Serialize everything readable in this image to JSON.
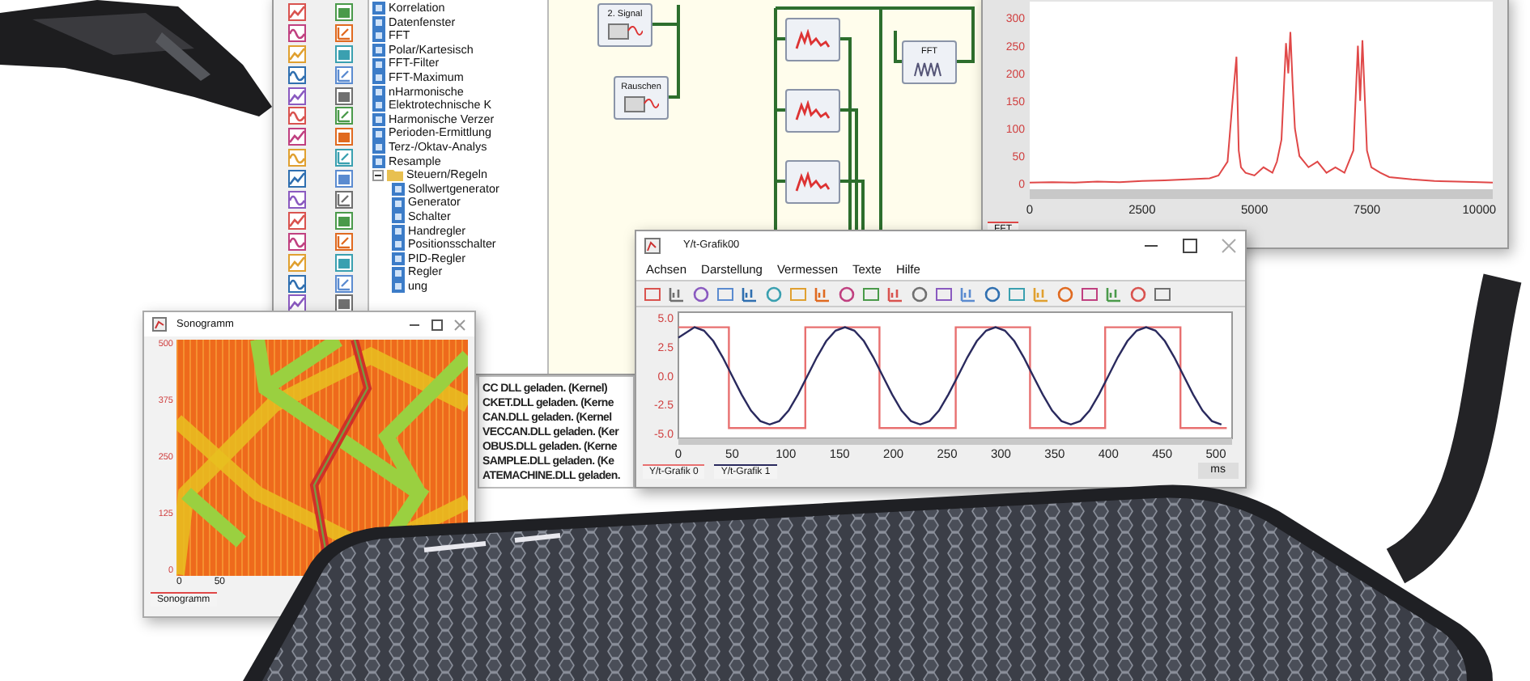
{
  "main_window": {
    "tree": {
      "items": [
        {
          "label": "Korrelation",
          "kind": "module"
        },
        {
          "label": "Datenfenster",
          "kind": "module"
        },
        {
          "label": "FFT",
          "kind": "module"
        },
        {
          "label": "Polar/Kartesisch",
          "kind": "module"
        },
        {
          "label": "FFT-Filter",
          "kind": "module"
        },
        {
          "label": "FFT-Maximum",
          "kind": "module"
        },
        {
          "label": "nHarmonische",
          "kind": "module"
        },
        {
          "label": "Elektrotechnische K",
          "kind": "module"
        },
        {
          "label": "Harmonische Verzer",
          "kind": "module"
        },
        {
          "label": "Perioden-Ermittlung",
          "kind": "module"
        },
        {
          "label": "Terz-/Oktav-Analys",
          "kind": "module"
        },
        {
          "label": "Resample",
          "kind": "module"
        },
        {
          "label": "Steuern/Regeln",
          "kind": "folder",
          "expanded": true,
          "children": [
            {
              "label": "Sollwertgenerator",
              "kind": "module"
            },
            {
              "label": "Generator",
              "kind": "module"
            },
            {
              "label": "Schalter",
              "kind": "module"
            },
            {
              "label": "Handregler",
              "kind": "module"
            },
            {
              "label": "Positionsschalter",
              "kind": "module"
            },
            {
              "label": "PID-Regler",
              "kind": "module"
            },
            {
              "label": "Regler",
              "kind": "module"
            },
            {
              "label": "ung",
              "kind": "module"
            }
          ]
        }
      ]
    },
    "diagram": {
      "blocks": [
        {
          "title": "2. Signal",
          "kind": "source"
        },
        {
          "title": "Rauschen",
          "kind": "source"
        },
        {
          "kind": "filter"
        },
        {
          "kind": "filter"
        },
        {
          "kind": "filter"
        },
        {
          "title": "FFT",
          "kind": "fft"
        }
      ]
    },
    "fft_window": {
      "chart_data": {
        "type": "line",
        "x": [
          0,
          500,
          1000,
          1500,
          2000,
          2500,
          3000,
          3500,
          4000,
          4200,
          4400,
          4500,
          4600,
          4650,
          4700,
          4800,
          5000,
          5200,
          5400,
          5500,
          5600,
          5700,
          5750,
          5800,
          5850,
          5900,
          6000,
          6200,
          6400,
          6600,
          6800,
          7000,
          7200,
          7300,
          7350,
          7400,
          7450,
          7500,
          7600,
          7800,
          8000,
          8500,
          9000,
          9500,
          10000,
          10300
        ],
        "series": [
          {
            "name": "FFT",
            "color": "#e04848",
            "values": [
              2,
              3,
              2,
              4,
              3,
              5,
              6,
              8,
              10,
              15,
              40,
              140,
              230,
              60,
              30,
              20,
              15,
              30,
              20,
              40,
              80,
              255,
              200,
              275,
              180,
              100,
              50,
              30,
              40,
              20,
              30,
              20,
              60,
              250,
              150,
              260,
              160,
              60,
              30,
              20,
              12,
              8,
              5,
              4,
              3,
              2
            ]
          }
        ],
        "xlim": [
          0,
          10300
        ],
        "ylim": [
          -10,
          330
        ],
        "xticks": [
          0,
          2500,
          5000,
          7500,
          10000
        ],
        "yticks": [
          0,
          50,
          100,
          150,
          200,
          250,
          300
        ]
      }
    },
    "log": {
      "lines": [
        "CC DLL geladen. (Kernel)",
        "CKET.DLL geladen. (Kerne",
        "CAN.DLL geladen. (Kernel",
        "VECCAN.DLL geladen. (Ker",
        "OBUS.DLL geladen. (Kerne",
        "SAMPLE.DLL geladen. (Ke",
        "ATEMACHINE.DLL geladen."
      ]
    }
  },
  "sonogram_window": {
    "title": "Sonogramm",
    "y_ticks": [
      "500",
      "375",
      "250",
      "125",
      "0"
    ],
    "x_ticks": [
      "0",
      "50"
    ],
    "legend": "Sonogramm"
  },
  "yt_window": {
    "title": "Y/t-Grafik00",
    "menu": [
      "Achsen",
      "Darstellung",
      "Vermessen",
      "Texte",
      "Hilfe"
    ],
    "chart_data": {
      "type": "line",
      "series": [
        {
          "name": "Y/t-Grafik 0",
          "color": "#e87070",
          "x": [
            0,
            47,
            47,
            118,
            118,
            187,
            187,
            258,
            258,
            327,
            327,
            397,
            397,
            467,
            467,
            510
          ],
          "values": [
            4.2,
            4.2,
            -4.5,
            -4.5,
            4.2,
            4.2,
            -4.5,
            -4.5,
            4.2,
            4.2,
            -4.5,
            -4.5,
            4.2,
            4.2,
            -4.5,
            -4.5
          ]
        },
        {
          "name": "Y/t-Grafik 1",
          "color": "#2a2a5e",
          "x": [
            0,
            15,
            23.75,
            32.5,
            41.25,
            50,
            58.75,
            67.5,
            76.25,
            85,
            93.75,
            102.5,
            111.25,
            120,
            128.75,
            137.5,
            146.25,
            155,
            163.75,
            172.5,
            181.25,
            190,
            198.75,
            207.5,
            216.25,
            225,
            233.75,
            242.5,
            251.25,
            260,
            268.75,
            277.5,
            286.25,
            295,
            303.75,
            312.5,
            321.25,
            330,
            338.75,
            347.5,
            356.25,
            365,
            373.75,
            382.5,
            391.25,
            400,
            408.75,
            417.5,
            426.25,
            435,
            443.75,
            452.5,
            461.25,
            470,
            478.75,
            487.5,
            496.25,
            505
          ],
          "values": [
            3.3,
            4.2,
            3.9,
            3.0,
            1.6,
            0,
            -1.6,
            -3.0,
            -3.9,
            -4.2,
            -3.9,
            -3.0,
            -1.6,
            0,
            1.6,
            3.0,
            3.9,
            4.2,
            3.9,
            3.0,
            1.6,
            0,
            -1.6,
            -3.0,
            -3.9,
            -4.2,
            -3.9,
            -3.0,
            -1.6,
            0,
            1.6,
            3.0,
            3.9,
            4.2,
            3.9,
            3.0,
            1.6,
            0,
            -1.6,
            -3.0,
            -3.9,
            -4.2,
            -3.9,
            -3.0,
            -1.6,
            0,
            1.6,
            3.0,
            3.9,
            4.2,
            3.9,
            3.0,
            1.6,
            0,
            -1.6,
            -3.0,
            -3.9,
            -4.2
          ]
        }
      ],
      "xlim": [
        0,
        515
      ],
      "ylim": [
        -5.4,
        5.5
      ],
      "xticks": [
        0,
        50,
        100,
        150,
        200,
        250,
        300,
        350,
        400,
        450,
        500
      ],
      "yticks": [
        {
          "value": -5,
          "label": "-5.0"
        },
        {
          "value": -2.5,
          "label": "-2.5"
        },
        {
          "value": 0,
          "label": "0.0"
        },
        {
          "value": 2.5,
          "label": "2.5"
        },
        {
          "value": 5,
          "label": "5.0"
        }
      ]
    },
    "unit": "ms"
  }
}
